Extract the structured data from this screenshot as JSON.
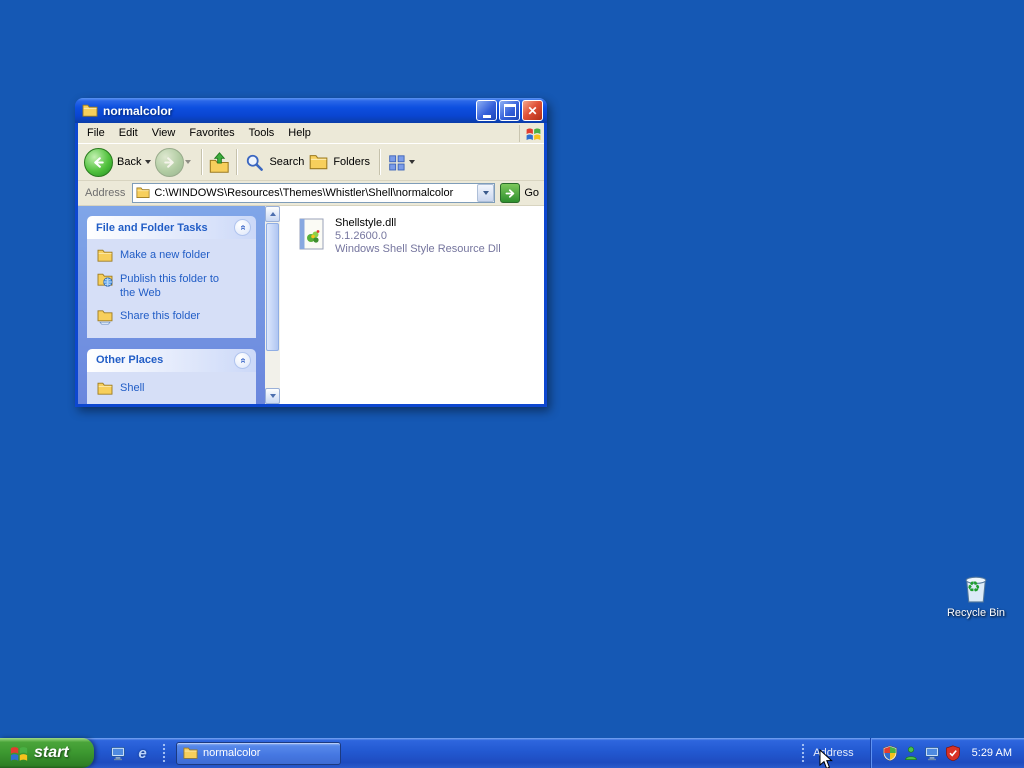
{
  "colors": {
    "desktop_blue": "#1558b4",
    "titlebar_blue": "#0d4fe0",
    "taskbar_blue": "#2258d0",
    "start_green": "#3c9730",
    "task_pane_link": "#215dc6",
    "close_red": "#e05238"
  },
  "window": {
    "title": "normalcolor",
    "menu": [
      "File",
      "Edit",
      "View",
      "Favorites",
      "Tools",
      "Help"
    ],
    "toolbar": {
      "back": "Back",
      "search": "Search",
      "folders": "Folders"
    },
    "address": {
      "label": "Address",
      "value": "C:\\WINDOWS\\Resources\\Themes\\Whistler\\Shell\\normalcolor",
      "go": "Go"
    },
    "task_panes": [
      {
        "title": "File and Folder Tasks",
        "items": [
          "Make a new folder",
          "Publish this folder to the Web",
          "Share this folder"
        ]
      },
      {
        "title": "Other Places",
        "items": [
          "Shell"
        ]
      }
    ],
    "file": {
      "name": "Shellstyle.dll",
      "version": "5.1.2600.0",
      "description": "Windows Shell Style Resource Dll"
    }
  },
  "desktop": {
    "recycle_bin": "Recycle Bin"
  },
  "taskbar": {
    "start": "start",
    "window_button": "normalcolor",
    "address_label": "Address",
    "clock": "5:29 AM"
  },
  "icons": {
    "close": "✕",
    "chevron": "«",
    "recycle": "♻",
    "ie_e": "e",
    "minimize": "underscore-shape",
    "maximize": "square-shape",
    "back": "green-circle-left-arrow",
    "forward": "green-circle-right-arrow",
    "up": "folder-with-up-arrow",
    "search": "magnifier",
    "folders": "folder-pane",
    "views": "grid",
    "go": "green-right-arrow",
    "windows_flag": "four-color-flag"
  }
}
